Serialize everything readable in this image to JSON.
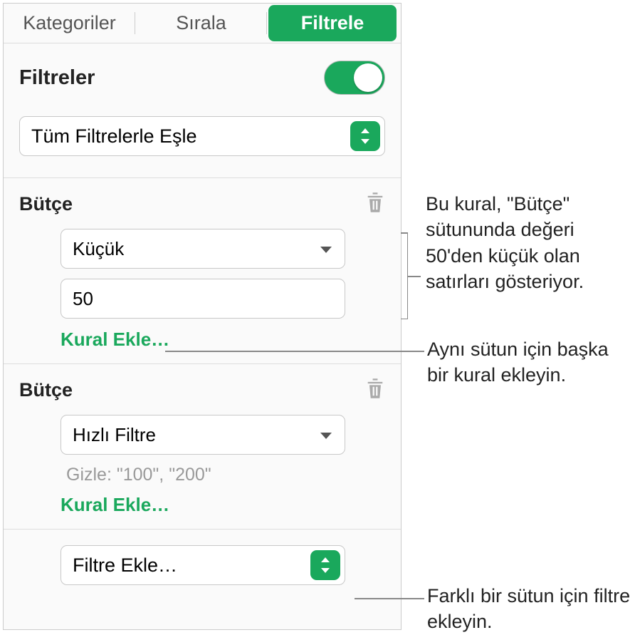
{
  "tabs": {
    "categories": "Kategoriler",
    "sort": "Sırala",
    "filter": "Filtrele"
  },
  "filters": {
    "title": "Filtreler",
    "match_mode": "Tüm Filtrelerle Eşle"
  },
  "block1": {
    "column": "Bütçe",
    "operator": "Küçük",
    "value": "50",
    "add_rule": "Kural Ekle…"
  },
  "block2": {
    "column": "Bütçe",
    "operator": "Hızlı Filtre",
    "hint": "Gizle: \"100\", \"200\"",
    "add_rule": "Kural Ekle…"
  },
  "add_filter": "Filtre Ekle…",
  "callouts": {
    "rule_desc": "Bu kural, \"Bütçe\" sütununda değeri 50'den küçük olan satırları gösteriyor.",
    "add_rule_desc": "Aynı sütun için başka bir kural ekleyin.",
    "add_filter_desc": "Farklı bir sütun için filtre ekleyin."
  }
}
